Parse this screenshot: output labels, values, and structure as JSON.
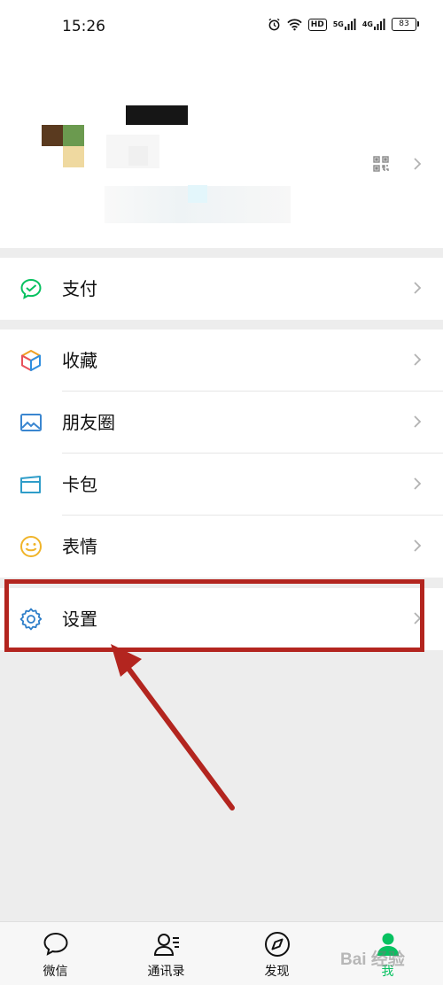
{
  "status_bar": {
    "time": "15:26",
    "hd_label": "HD",
    "network_1": "5G",
    "network_2": "4G",
    "battery": "83"
  },
  "menu_group_1": [
    {
      "label": "支付",
      "icon": "wechat-pay-icon"
    }
  ],
  "menu_group_2": [
    {
      "label": "收藏",
      "icon": "favorites-cube-icon"
    },
    {
      "label": "朋友圈",
      "icon": "moments-image-icon"
    },
    {
      "label": "卡包",
      "icon": "card-wallet-icon"
    },
    {
      "label": "表情",
      "icon": "emoji-smile-icon"
    }
  ],
  "menu_group_3": [
    {
      "label": "设置",
      "icon": "settings-gear-icon"
    }
  ],
  "tabbar": {
    "tabs": [
      {
        "label": "微信",
        "icon": "chat-bubble-icon"
      },
      {
        "label": "通讯录",
        "icon": "contacts-icon"
      },
      {
        "label": "发现",
        "icon": "compass-icon"
      },
      {
        "label": "我",
        "icon": "me-person-icon",
        "active": true
      }
    ]
  },
  "watermark": "Bai 经验",
  "colors": {
    "accent_green": "#07c160",
    "highlight_red": "#b3251f",
    "background": "#ededed"
  }
}
